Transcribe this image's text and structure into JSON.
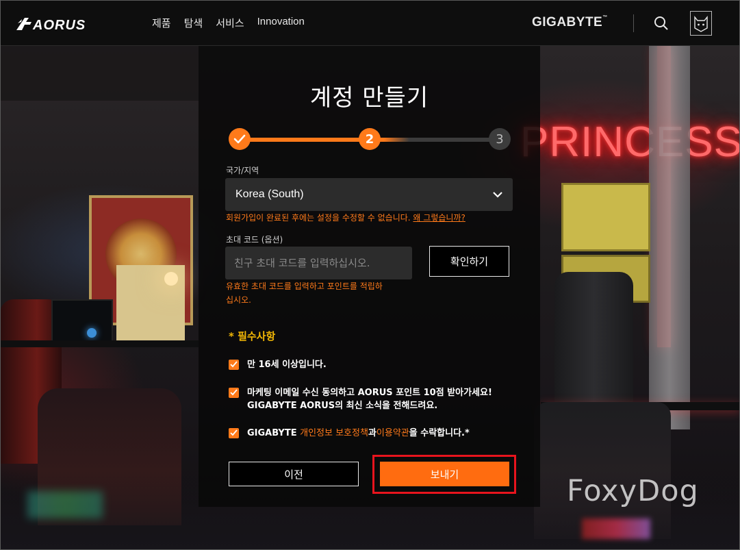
{
  "header": {
    "logo_text": "AORUS",
    "nav": [
      "제품",
      "탐색",
      "서비스",
      "Innovation"
    ],
    "brand": "GIGABYTE",
    "brand_mark": "™"
  },
  "page": {
    "title": "계정 만들기",
    "steps": [
      {
        "label": "",
        "state": "done"
      },
      {
        "label": "2",
        "state": "active"
      },
      {
        "label": "3",
        "state": "pending"
      }
    ],
    "accent_color": "#ff7a1a"
  },
  "form": {
    "country_label": "국가/지역",
    "country_value": "Korea (South)",
    "country_note": "회원가입이 완료된 후에는 설정을 수정할 수 없습니다.",
    "country_note_link": "왜 그렇습니까?",
    "invite_label": "초대 코드 (옵션)",
    "invite_placeholder": "친구 초대 코드를 입력하십시오.",
    "confirm_button": "확인하기",
    "invite_note_line1": "유효한 초대 코드를 입력하고 포인트를 적립하",
    "invite_note_line2": "십시오.",
    "required_heading": "* 필수사항",
    "checks": {
      "age": "만 16세 이상입니다.",
      "marketing_line1": "마케팅 이메일 수신 동의하고 AORUS 포인트 10점 받아가세요!",
      "marketing_line2": "GIGABYTE AORUS의 최신 소식을 전해드려요.",
      "terms_prefix": "GIGABYTE ",
      "terms_privacy": "개인정보 보호정책",
      "terms_and": "과",
      "terms_tos": "이용약관",
      "terms_suffix": "을 수락합니다.*"
    },
    "prev_button": "이전",
    "send_button": "보내기"
  },
  "background": {
    "neon_text": "PRINCESS"
  },
  "watermark": "FoxyDog"
}
